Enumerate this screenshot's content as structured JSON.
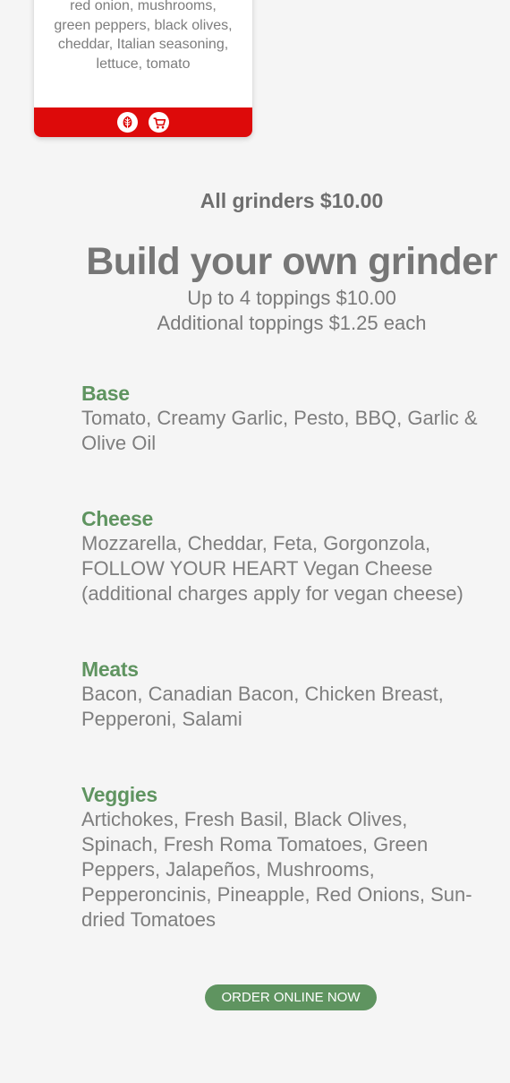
{
  "card": {
    "ingredients_lines": [
      "red onion, mushrooms,",
      "green peppers, black olives,",
      "cheddar, Italian seasoning,",
      "lettuce, tomato"
    ],
    "footer_color": "#dd0a0a",
    "icons": [
      "veggie-leaf-icon",
      "cart-icon"
    ]
  },
  "pricing": {
    "all_grinders": "All grinders $10.00"
  },
  "build": {
    "title": "Build your own grinder",
    "sub1": "Up to 4 toppings $10.00",
    "sub2": "Additional toppings $1.25 each"
  },
  "sections": [
    {
      "heading": "Base",
      "lines": [
        "Tomato, Creamy Garlic, Pesto, BBQ, Garlic &",
        "Olive Oil"
      ]
    },
    {
      "heading": "Cheese",
      "lines": [
        "Mozzarella, Cheddar, Feta, Gorgonzola,",
        "FOLLOW YOUR HEART Vegan Cheese",
        "(additional charges apply for vegan cheese)"
      ]
    },
    {
      "heading": "Meats",
      "lines": [
        "Bacon, Canadian Bacon, Chicken Breast,",
        "Pepperoni, Salami"
      ]
    },
    {
      "heading": "Veggies",
      "lines": [
        "Artichokes, Fresh Basil, Black Olives,",
        "Spinach, Fresh Roma Tomatoes, Green",
        "Peppers, Jalapeños, Mushrooms,",
        "Pepperoncinis, Pineapple, Red Onions, Sun-",
        "dried Tomatoes"
      ]
    }
  ],
  "order_button": {
    "label": "ORDER ONLINE NOW"
  },
  "colors": {
    "accent_green": "#5f9460",
    "text_gray": "#777777",
    "background": "#f5f5f5"
  }
}
